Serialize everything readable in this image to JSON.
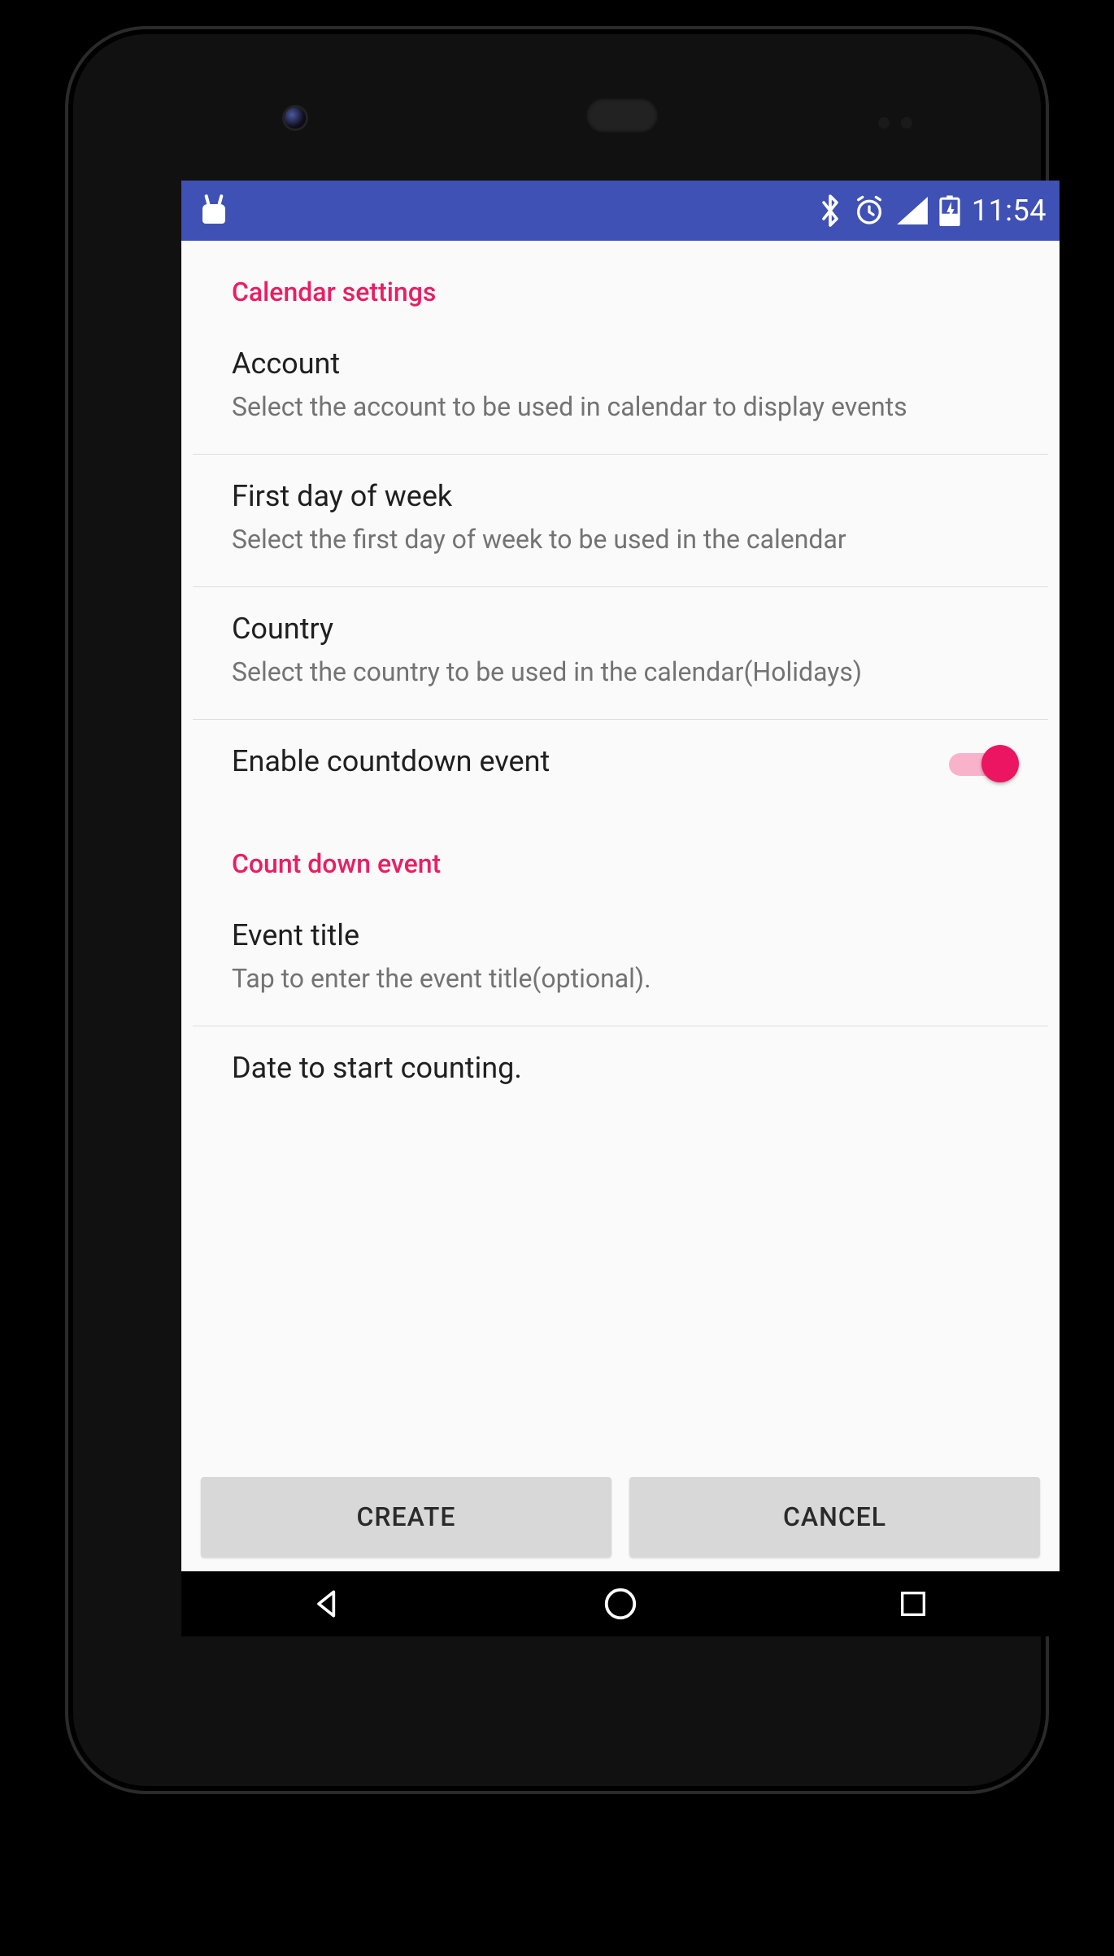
{
  "statusbar": {
    "time": "11:54"
  },
  "sections": {
    "calendar_settings": {
      "header": "Calendar settings",
      "account": {
        "title": "Account",
        "sub": "Select the account to be used in calendar to display events"
      },
      "first_day": {
        "title": "First day of week",
        "sub": "Select the first day of week to be used in the calendar"
      },
      "country": {
        "title": "Country",
        "sub": "Select the country to be used in the calendar(Holidays)"
      },
      "enable_countdown": {
        "title": "Enable countdown event",
        "enabled": true
      }
    },
    "countdown_event": {
      "header": "Count down event",
      "event_title": {
        "title": "Event title",
        "sub": "Tap to enter the event title(optional)."
      },
      "date_start": {
        "title": "Date to start counting."
      }
    }
  },
  "buttons": {
    "create": "CREATE",
    "cancel": "CANCEL"
  },
  "colors": {
    "primary": "#3f51b5",
    "accent": "#e91e63"
  }
}
